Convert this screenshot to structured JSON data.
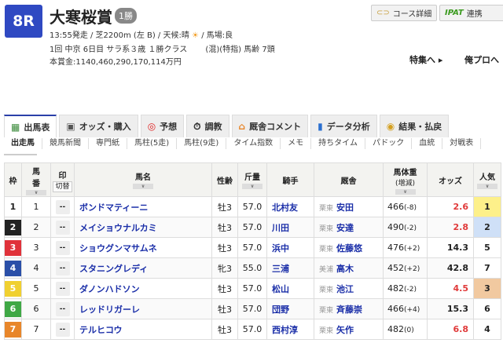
{
  "race": {
    "number": "8R",
    "title": "大寒桜賞",
    "grade": "1勝",
    "line1": "13:55発走 / 芝2200m (左 B) / 天候:晴",
    "weather_icon": "sun-icon",
    "line1b": "/ 馬場:良",
    "line2": "1回 中京 6日目 サラ系３歳 １勝クラス　　 (混)(特指) 馬齢 7頭",
    "prize": "本賞金:1140,460,290,170,114万円"
  },
  "buttons": {
    "course": "コース詳細",
    "ipat_logo": "IPAT",
    "ipat": "連携"
  },
  "links": {
    "feature": "特集へ ▸",
    "blog": "俺プロへ"
  },
  "tabs": [
    {
      "label": "出馬表",
      "icon": "table-icon"
    },
    {
      "label": "オッズ・購入",
      "icon": "odds-icon"
    },
    {
      "label": "予想",
      "icon": "target-icon"
    },
    {
      "label": "調教",
      "icon": "stopwatch-icon"
    },
    {
      "label": "厩舎コメント",
      "icon": "stable-icon"
    },
    {
      "label": "データ分析",
      "icon": "chart-icon"
    },
    {
      "label": "結果・払戻",
      "icon": "coins-icon"
    }
  ],
  "subtabs": [
    "出走馬",
    "競馬新聞",
    "専門紙",
    "馬柱(5走)",
    "馬柱(9走)",
    "タイム指数",
    "メモ",
    "持ちタイム",
    "パドック",
    "血統",
    "対戦表"
  ],
  "headers": {
    "waku": "枠",
    "umaban": "馬\n番",
    "mark": "印",
    "toggle": "切替",
    "name": "馬名",
    "sexage": "性齢",
    "weight": "斤量",
    "jockey": "騎手",
    "stable": "厩舎",
    "body": "馬体重",
    "body_sub": "(増減)",
    "odds": "オッズ",
    "pop": "人気"
  },
  "colors": {
    "frames": [
      "#ffffff",
      "#222222",
      "#e0323a",
      "#2a4fa8",
      "#f0d030",
      "#3fa845",
      "#e8862a"
    ],
    "odds_red": "#e03a3a",
    "pop1": "#fdf08a",
    "pop2": "#cfe0f7",
    "pop3": "#f1c9a0"
  },
  "horses": [
    {
      "waku": "1",
      "num": "1",
      "mark": "--",
      "name": "ボンドマティーニ",
      "sexage": "牡3",
      "weight": "57.0",
      "jockey": "北村友",
      "loc": "栗東",
      "trainer": "安田",
      "body": "466",
      "diff": "(-8)",
      "odds": "2.6",
      "pop": "1"
    },
    {
      "waku": "2",
      "num": "2",
      "mark": "--",
      "name": "メイショウナルカミ",
      "sexage": "牡3",
      "weight": "57.0",
      "jockey": "川田",
      "loc": "栗東",
      "trainer": "安達",
      "body": "490",
      "diff": "(-2)",
      "odds": "2.8",
      "pop": "2"
    },
    {
      "waku": "3",
      "num": "3",
      "mark": "--",
      "name": "ショウグンマサムネ",
      "sexage": "牡3",
      "weight": "57.0",
      "jockey": "浜中",
      "loc": "栗東",
      "trainer": "佐藤悠",
      "body": "476",
      "diff": "(+2)",
      "odds": "14.3",
      "pop": "5"
    },
    {
      "waku": "4",
      "num": "4",
      "mark": "--",
      "name": "スタニングレディ",
      "sexage": "牝3",
      "weight": "55.0",
      "jockey": "三浦",
      "loc": "美浦",
      "trainer": "高木",
      "body": "452",
      "diff": "(+2)",
      "odds": "42.8",
      "pop": "7"
    },
    {
      "waku": "5",
      "num": "5",
      "mark": "--",
      "name": "ダノンハドソン",
      "sexage": "牡3",
      "weight": "57.0",
      "jockey": "松山",
      "loc": "栗東",
      "trainer": "池江",
      "body": "482",
      "diff": "(-2)",
      "odds": "4.5",
      "pop": "3"
    },
    {
      "waku": "6",
      "num": "6",
      "mark": "--",
      "name": "レッドリガーレ",
      "sexage": "牡3",
      "weight": "57.0",
      "jockey": "団野",
      "loc": "栗東",
      "trainer": "斉藤崇",
      "body": "466",
      "diff": "(+4)",
      "odds": "15.3",
      "pop": "6"
    },
    {
      "waku": "7",
      "num": "7",
      "mark": "--",
      "name": "テルヒコウ",
      "sexage": "牡3",
      "weight": "57.0",
      "jockey": "西村淳",
      "loc": "栗東",
      "trainer": "矢作",
      "body": "482",
      "diff": "(0)",
      "odds": "6.8",
      "pop": "4"
    }
  ]
}
